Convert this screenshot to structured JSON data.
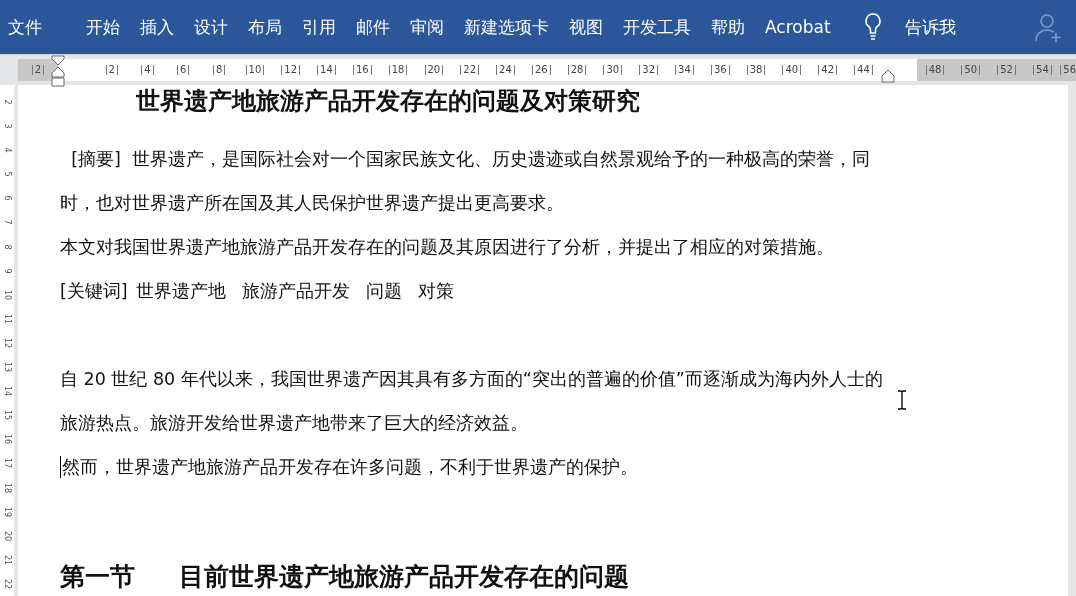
{
  "ribbon": {
    "tabs": [
      "文件",
      "开始",
      "插入",
      "设计",
      "布局",
      "引用",
      "邮件",
      "审阅",
      "新建选项卡",
      "视图",
      "开发工具",
      "帮助",
      "Acrobat"
    ],
    "tell_me": "告诉我"
  },
  "ruler": {
    "left_margin_labels": [
      "2"
    ],
    "labels": [
      "2",
      "4",
      "6",
      "8",
      "10",
      "12",
      "14",
      "16",
      "18",
      "20",
      "22",
      "24",
      "26",
      "28",
      "30",
      "32",
      "34",
      "36",
      "38",
      "40",
      "42",
      "44"
    ],
    "right_margin_labels": [
      "48",
      "50",
      "52",
      "54",
      "56"
    ]
  },
  "vertical_ruler": {
    "labels": [
      "2",
      "3",
      "4",
      "5",
      "6",
      "7",
      "8",
      "9",
      "10",
      "11",
      "12",
      "13",
      "14",
      "15",
      "16",
      "17",
      "18",
      "19",
      "20",
      "21",
      "22"
    ]
  },
  "document": {
    "title": "世界遗产地旅游产品开发存在的问题及对策研究",
    "paragraphs": [
      {
        "kind": "abstract",
        "label": "[摘要]",
        "text": "世界遗产，是国际社会对一个国家民族文化、历史遗迹或自然景观给予的一种极高的荣誉，同时，也对世界遗产所在国及其人民保护世界遗产提出更高要求。"
      },
      {
        "kind": "text",
        "text": "本文对我国世界遗产地旅游产品开发存在的问题及其原因进行了分析，并提出了相应的对策措施。"
      },
      {
        "kind": "keywords",
        "label": "[关键词]",
        "keywords": [
          "世界遗产地",
          "旅游产品开发",
          "问题",
          "对策"
        ]
      },
      {
        "kind": "blank"
      },
      {
        "kind": "text",
        "text": "自 20 世纪 80 年代以来，我国世界遗产因其具有多方面的“突出的普遍的价值”而逐渐成为海内外人士的旅游热点。旅游开发给世界遗产地带来了巨大的经济效益。"
      },
      {
        "kind": "text",
        "text": "然而，世界遗产地旅游产品开发存在许多问题，不利于世界遗产的保护。",
        "caret": true
      },
      {
        "kind": "blank"
      },
      {
        "kind": "heading",
        "number": "第一节",
        "text": "目前世界遗产地旅游产品开发存在的问题"
      }
    ]
  }
}
